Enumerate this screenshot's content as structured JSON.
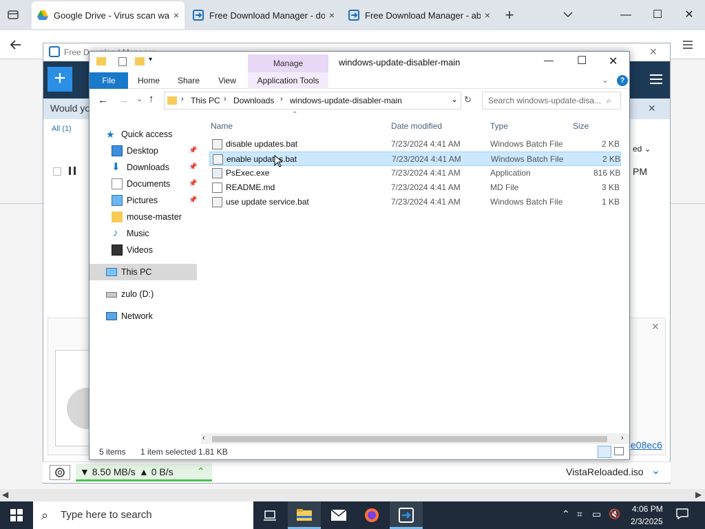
{
  "browser": {
    "tabs": [
      {
        "title": "Google Drive - Virus scan warni",
        "active": true
      },
      {
        "title": "Free Download Manager - dow",
        "active": false
      },
      {
        "title": "Free Download Manager - abso",
        "active": false
      }
    ],
    "new_tab": "+",
    "tab_close": "×",
    "minimize": "—",
    "maximize": "☐",
    "close": "✕"
  },
  "fdm": {
    "title": "Free Download Manager",
    "notice": "Would yo",
    "filter_all": "All (1)",
    "status_right": "PM",
    "speed_down": "▼ 8.50 MB/s",
    "speed_up": "▲ 0 B/s",
    "current_file": "VistaReloaded.iso",
    "hash_link": "e08ec6",
    "sort_label": "ed ⌄"
  },
  "explorer": {
    "title": "windows-update-disabler-main",
    "manage_label": "Manage",
    "ribbon": {
      "file": "File",
      "home": "Home",
      "share": "Share",
      "view": "View",
      "app_tools": "Application Tools"
    },
    "breadcrumb": [
      "This PC",
      "Downloads",
      "windows-update-disabler-main"
    ],
    "search_placeholder": "Search windows-update-disa...",
    "nav": {
      "quick_access": "Quick access",
      "items": [
        {
          "label": "Desktop",
          "pinned": true
        },
        {
          "label": "Downloads",
          "pinned": true
        },
        {
          "label": "Documents",
          "pinned": true
        },
        {
          "label": "Pictures",
          "pinned": true
        },
        {
          "label": "mouse-master",
          "pinned": false
        },
        {
          "label": "Music",
          "pinned": false
        },
        {
          "label": "Videos",
          "pinned": false
        }
      ],
      "this_pc": "This PC",
      "drive": "zulo (D:)",
      "network": "Network"
    },
    "columns": {
      "name": "Name",
      "date": "Date modified",
      "type": "Type",
      "size": "Size"
    },
    "files": [
      {
        "name": "disable updates.bat",
        "date": "7/23/2024 4:41 AM",
        "type": "Windows Batch File",
        "size": "2 KB",
        "selected": false
      },
      {
        "name": "enable updates.bat",
        "date": "7/23/2024 4:41 AM",
        "type": "Windows Batch File",
        "size": "2 KB",
        "selected": true
      },
      {
        "name": "PsExec.exe",
        "date": "7/23/2024 4:41 AM",
        "type": "Application",
        "size": "816 KB",
        "selected": false
      },
      {
        "name": "README.md",
        "date": "7/23/2024 4:41 AM",
        "type": "MD File",
        "size": "3 KB",
        "selected": false
      },
      {
        "name": "use update service.bat",
        "date": "7/23/2024 4:41 AM",
        "type": "Windows Batch File",
        "size": "1 KB",
        "selected": false
      }
    ],
    "status": {
      "count": "5 items",
      "selected": "1 item selected",
      "size": "1.81 KB"
    }
  },
  "taskbar": {
    "search_placeholder": "Type here to search",
    "time": "4:06 PM",
    "date": "2/3/2025"
  },
  "colors": {
    "accent": "#1979ca",
    "selection": "#cce8ff",
    "manage": "#e9d8f6",
    "fdm_header": "#1d3a57"
  }
}
